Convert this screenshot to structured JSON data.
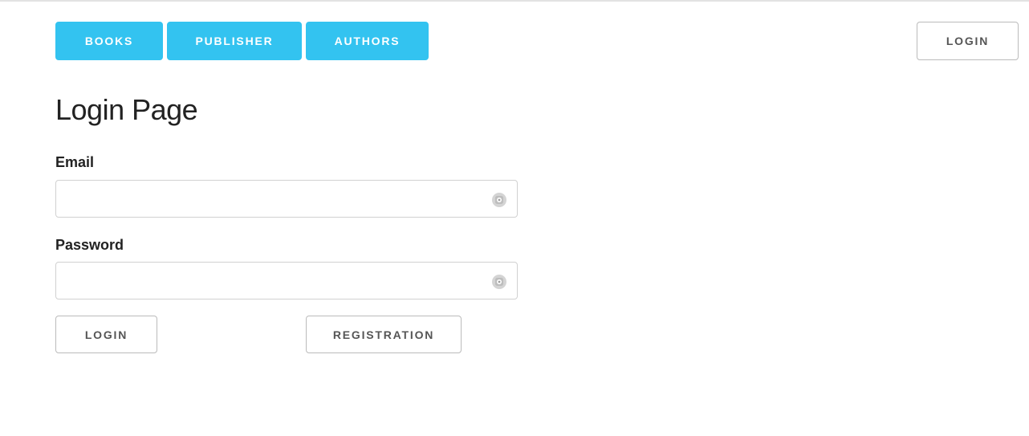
{
  "nav": {
    "items": [
      {
        "label": "BOOKS"
      },
      {
        "label": "PUBLISHER"
      },
      {
        "label": "AUTHORS"
      }
    ],
    "login_label": "LOGIN"
  },
  "page": {
    "title": "Login Page"
  },
  "form": {
    "email": {
      "label": "Email",
      "value": "",
      "placeholder": "",
      "icon": "password-manager-icon"
    },
    "password": {
      "label": "Password",
      "value": "",
      "placeholder": "",
      "icon": "password-manager-icon"
    },
    "login_label": "LOGIN",
    "registration_label": "REGISTRATION"
  },
  "colors": {
    "accent": "#33c3f0",
    "border": "#bbbbbb",
    "text": "#222222"
  }
}
